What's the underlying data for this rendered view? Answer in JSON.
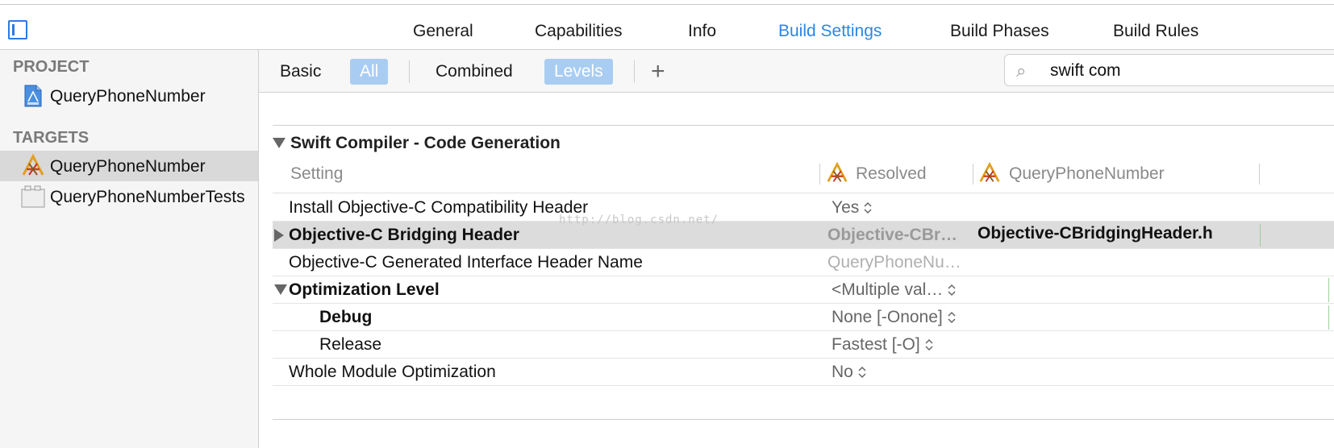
{
  "tabs": [
    {
      "label": "General"
    },
    {
      "label": "Capabilities"
    },
    {
      "label": "Info"
    },
    {
      "label": "Build Settings"
    },
    {
      "label": "Build Phases"
    },
    {
      "label": "Build Rules"
    }
  ],
  "active_tab": "Build Settings",
  "sidebar": {
    "project_header": "PROJECT",
    "project_item": "QueryPhoneNumber",
    "targets_header": "TARGETS",
    "targets": [
      {
        "label": "QueryPhoneNumber",
        "selected": true
      },
      {
        "label": "QueryPhoneNumberTests",
        "selected": false
      }
    ]
  },
  "filter": {
    "basic": "Basic",
    "all": "All",
    "combined": "Combined",
    "levels": "Levels",
    "add": "+"
  },
  "search": {
    "value": "swift com"
  },
  "group": {
    "title": "Swift Compiler - Code Generation",
    "col_setting": "Setting",
    "col_resolved": "Resolved",
    "col_target": "QueryPhoneNumber"
  },
  "rows": [
    {
      "name": "Install Objective-C Compatibility Header",
      "resolved": "Yes"
    },
    {
      "name": "Objective-C Bridging Header",
      "resolved": "Objective-CBr…",
      "target": "Objective-CBridgingHeader.h"
    },
    {
      "name": "Objective-C Generated Interface Header Name",
      "resolved": "QueryPhoneNu…"
    },
    {
      "name": "Optimization Level",
      "resolved": "<Multiple val…"
    },
    {
      "name": "Debug",
      "resolved": "None [-Onone]"
    },
    {
      "name": "Release",
      "resolved": "Fastest [-O]"
    },
    {
      "name": "Whole Module Optimization",
      "resolved": "No"
    }
  ],
  "watermark": "http://blog.csdn.net/",
  "colors": {
    "accent": "#2c86e2",
    "filter_on": "#a9cdf2"
  }
}
